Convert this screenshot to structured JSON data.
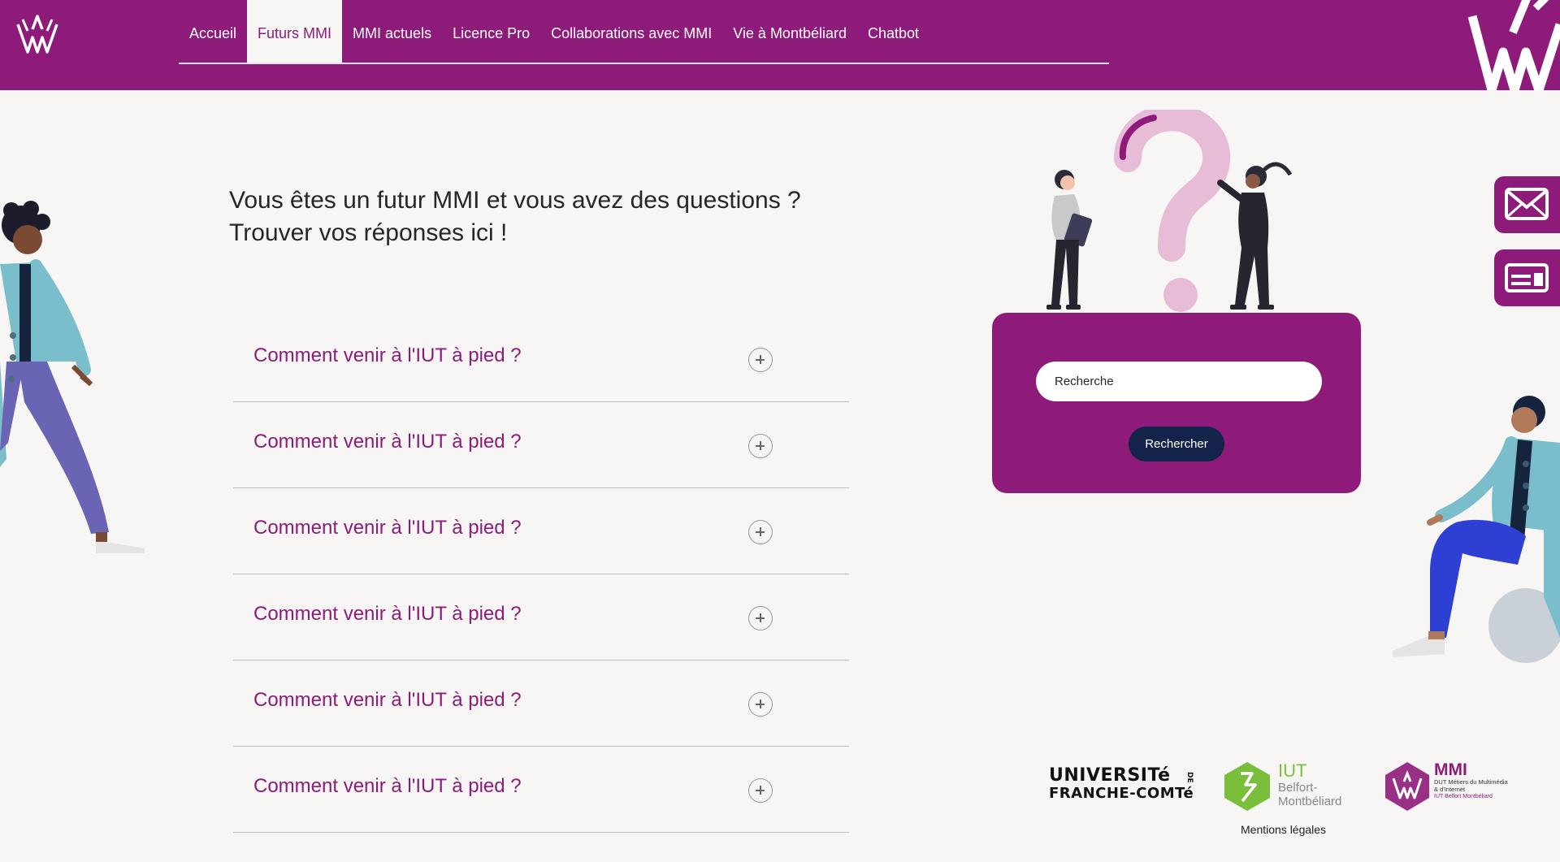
{
  "header": {
    "nav": [
      {
        "label": "Accueil",
        "active": false
      },
      {
        "label": "Futurs MMI",
        "active": true
      },
      {
        "label": "MMI actuels",
        "active": false
      },
      {
        "label": "Licence Pro",
        "active": false
      },
      {
        "label": "Collaborations avec MMI",
        "active": false
      },
      {
        "label": "Vie à Montbéliard",
        "active": false
      },
      {
        "label": "Chatbot",
        "active": false
      }
    ]
  },
  "main": {
    "title_line1": "Vous êtes un futur MMI et vous avez des questions ?",
    "title_line2": "Trouver vos réponses ici !",
    "faq": [
      "Comment venir à l'IUT à pied ?",
      "Comment venir à l'IUT à pied ?",
      "Comment venir à l'IUT à pied ?",
      "Comment venir à l'IUT à pied ?",
      "Comment venir à l'IUT à pied ?",
      "Comment venir à l'IUT à pied ?"
    ]
  },
  "search": {
    "placeholder": "Recherche",
    "button_label": "Rechercher"
  },
  "side_tabs": [
    "mail-icon",
    "newsletter-icon"
  ],
  "footer": {
    "ufc_line1": "UNIVERSITé",
    "ufc_de": "DE",
    "ufc_line2": "FRANCHE-COMTé",
    "iut_title": "IUT",
    "iut_line1": "Belfort-",
    "iut_line2": "Montbéliard",
    "mmi_title": "MMI",
    "mmi_line1": "DUT Métiers du Multimédia",
    "mmi_line2": "& d'Internet",
    "mmi_line3": "IUT Belfort Montbéliard",
    "legal": "Mentions légales"
  },
  "colors": {
    "brand": "#8e1b7a",
    "navy": "#13234a",
    "background": "#f7f6f4",
    "iut_green": "#7bbe3b"
  }
}
